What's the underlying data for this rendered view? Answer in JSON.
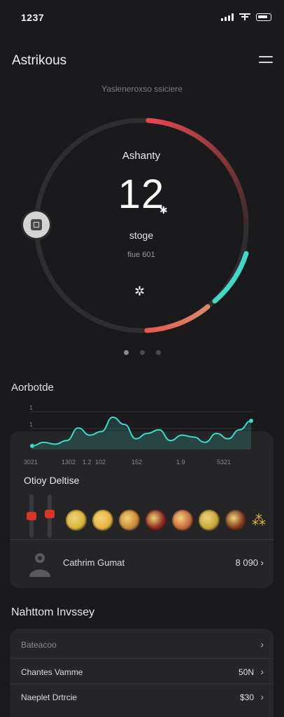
{
  "status": {
    "time": "1237"
  },
  "header": {
    "title": "Astrikous",
    "subtitle": "Yasleneroxso ssiciere"
  },
  "ring": {
    "label": "Ashanty",
    "value": "12",
    "unit": "stoge",
    "caption": "fiue 601",
    "icon_names": [
      "star-icon",
      "bolt-icon",
      "square-icon"
    ],
    "colors": {
      "track": "#2e2e30",
      "red": "#e8474f",
      "teal": "#3fd9c6",
      "salmon": "#e8735f"
    }
  },
  "pager": {
    "count": 3,
    "active_index": 0
  },
  "chart": {
    "title": "Aorbotde",
    "tick_labels": [
      "3021",
      "1302",
      "1.2",
      "102",
      "152",
      "1.9",
      "5321"
    ],
    "y_marks": [
      "1",
      "1"
    ],
    "color": "#3fd9c6"
  },
  "chart_data": {
    "type": "area",
    "x": [
      0,
      1,
      2,
      3,
      4,
      5,
      6,
      7,
      8,
      9,
      10,
      11,
      12,
      13,
      14,
      15,
      16,
      17,
      18,
      19
    ],
    "values": [
      2,
      4,
      3,
      5,
      12,
      8,
      10,
      18,
      14,
      6,
      9,
      11,
      5,
      8,
      7,
      4,
      9,
      6,
      11,
      16
    ],
    "title": "Aorbotde",
    "xlabel": "",
    "ylabel": "",
    "ylim": [
      0,
      25
    ]
  },
  "daily": {
    "title": "Otioy Deltise",
    "slider_levels": [
      0.5,
      0.55
    ],
    "foods": [
      "#d8b43a",
      "#e6b542",
      "#c98a3a",
      "#8a2a22",
      "#c86a3e",
      "#c7a83a",
      "#7a3a22"
    ],
    "food_last_icon": "fries-icon"
  },
  "profile": {
    "name": "Cathrim Gumat",
    "value": "8 090"
  },
  "section2": {
    "title": "Nahttom Invssey",
    "rows": [
      {
        "label": "Bateacoo",
        "value": ""
      },
      {
        "label": "Chantes Vamme",
        "value": "50N"
      },
      {
        "label": "Naeplet Drtrcie",
        "value": "$30"
      }
    ]
  }
}
